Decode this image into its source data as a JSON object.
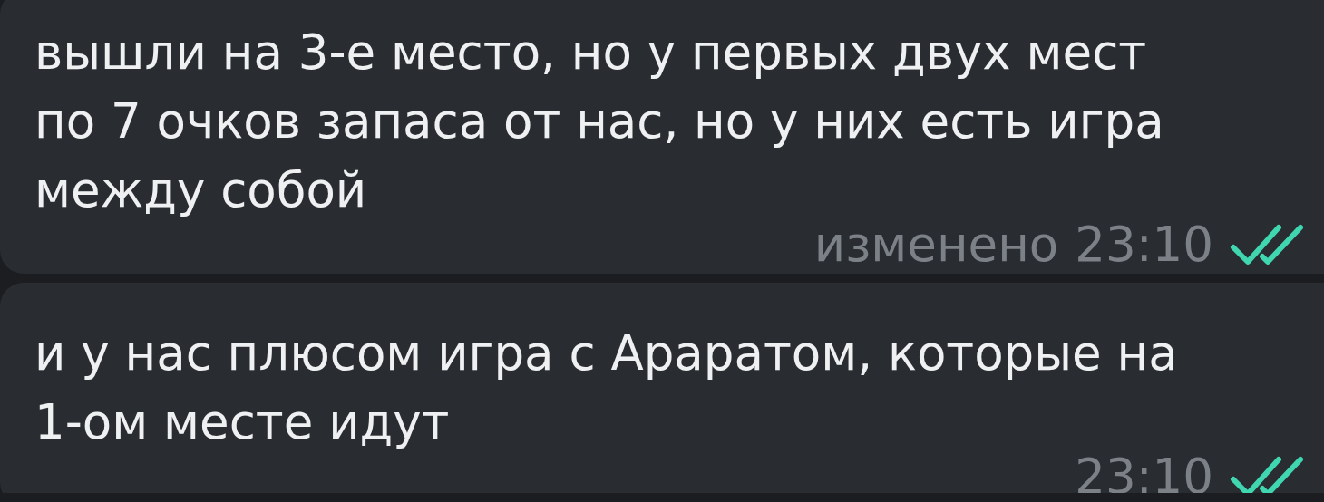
{
  "messages": [
    {
      "text": "вышли на 3-е место, но у первых двух мест\nпо 7 очков запаса от нас, но у них есть игра\nмежду собой",
      "edited": "изменено",
      "time": "23:10",
      "read": true
    },
    {
      "text": "и у нас плюсом игра с Араратом, которые на\n1-ом месте идут",
      "time": "23:10",
      "read": true
    }
  ]
}
